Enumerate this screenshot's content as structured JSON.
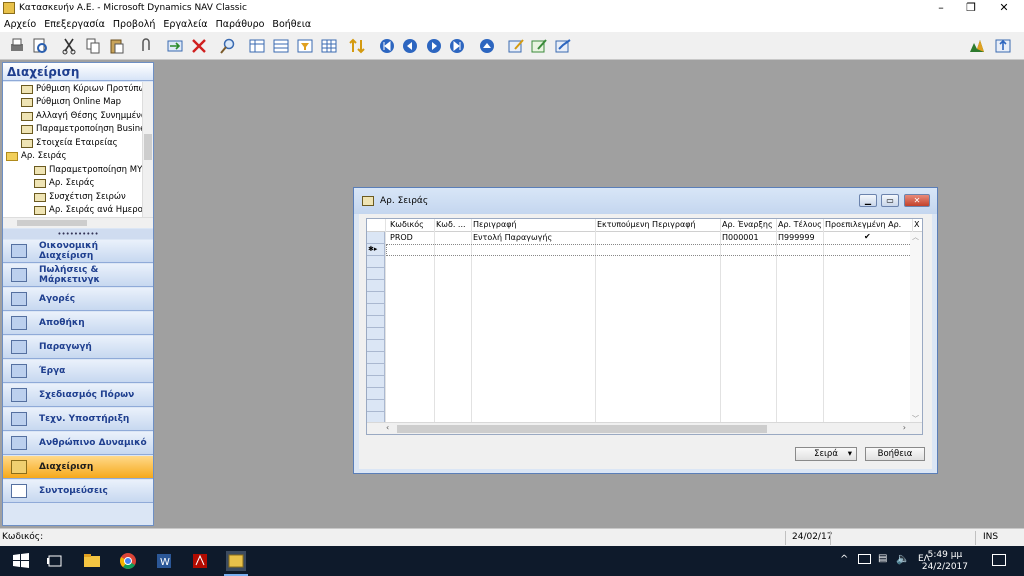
{
  "app": {
    "title": "Κατασκευήν Α.Ε. - Microsoft Dynamics NAV Classic",
    "window_buttons": [
      "–",
      "❐",
      "✕"
    ]
  },
  "menu": [
    "Αρχείο",
    "Επεξεργασία",
    "Προβολή",
    "Εργαλεία",
    "Παράθυρο",
    "Βοήθεια"
  ],
  "nav": {
    "title": "Διαχείριση",
    "tree": [
      {
        "label": "Ρύθμιση Κύριων Προτύπω",
        "type": "table",
        "indent": 1
      },
      {
        "label": "Ρύθμιση Online Map",
        "type": "table",
        "indent": 1
      },
      {
        "label": "Αλλαγή Θέσης Συνημμένω",
        "type": "table",
        "indent": 1
      },
      {
        "label": "Παραμετροποίηση Busines",
        "type": "table",
        "indent": 1
      },
      {
        "label": "Στοιχεία Εταιρείας",
        "type": "table",
        "indent": 1
      },
      {
        "label": "Αρ. Σειράς",
        "type": "folder",
        "indent": 0
      },
      {
        "label": "Παραμετροποίηση ΜΥ",
        "type": "table",
        "indent": 2
      },
      {
        "label": "Αρ. Σειράς",
        "type": "table",
        "indent": 2
      },
      {
        "label": "Συσχέτιση Σειρών",
        "type": "table",
        "indent": 2
      },
      {
        "label": "Αρ. Σειράς ανά Ημερολ",
        "type": "table",
        "indent": 2
      }
    ],
    "buttons": [
      {
        "label": "Οικονομική Διαχείριση",
        "active": false
      },
      {
        "label": "Πωλήσεις & Μάρκετινγκ",
        "active": false
      },
      {
        "label": "Αγορές",
        "active": false
      },
      {
        "label": "Αποθήκη",
        "active": false
      },
      {
        "label": "Παραγωγή",
        "active": false
      },
      {
        "label": "Έργα",
        "active": false
      },
      {
        "label": "Σχεδιασμός Πόρων",
        "active": false
      },
      {
        "label": "Τεχν. Υποστήριξη",
        "active": false
      },
      {
        "label": "Ανθρώπινο Δυναμικό",
        "active": false
      },
      {
        "label": "Διαχείριση",
        "active": true
      },
      {
        "label": "Συντομεύσεις",
        "active": false
      }
    ]
  },
  "form": {
    "title": "Αρ. Σειράς",
    "columns": [
      "Κωδικός",
      "Κωδ. ...",
      "Περιγραφή",
      "Εκτυπούμενη Περιγραφή",
      "Αρ. Έναρξης",
      "Αρ. Τέλους",
      "Προεπιλεγμένη Αρ.",
      "Χ"
    ],
    "rows": [
      [
        "PROD",
        "",
        "Εντολή Παραγωγής",
        "",
        "Π000001",
        "Π999999",
        "✔",
        ""
      ]
    ],
    "current_row_marker": "✱▸",
    "buttons": {
      "series": "Σειρά",
      "help": "Βοήθεια"
    }
  },
  "status": {
    "field": "Κωδικός:",
    "date": "24/02/17",
    "mode": "INS"
  },
  "taskbar": {
    "language": "ΕΛ",
    "time": "5:49 μμ",
    "date": "24/2/2017"
  },
  "colors": {
    "nav_accent": "#f6a91b",
    "nav_text": "#1f3f8f",
    "desktop": "#a0a0a0",
    "taskbar": "#0e1a2b"
  }
}
